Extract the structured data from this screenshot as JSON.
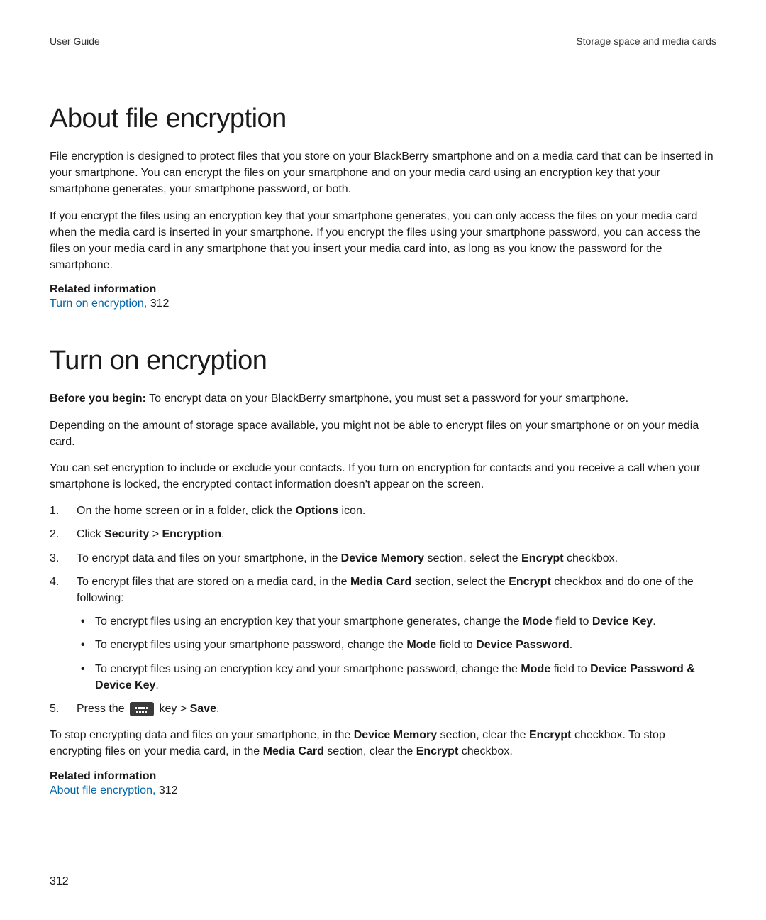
{
  "header": {
    "left": "User Guide",
    "right": "Storage space and media cards"
  },
  "section1": {
    "title": "About file encryption",
    "p1": "File encryption is designed to protect files that you store on your BlackBerry smartphone and on a media card that can be inserted in your smartphone. You can encrypt the files on your smartphone and on your media card using an encryption key that your smartphone generates, your smartphone password, or both.",
    "p2": "If you encrypt the files using an encryption key that your smartphone generates, you can only access the files on your media card when the media card is inserted in your smartphone. If you encrypt the files using your smartphone password, you can access the files on your media card in any smartphone that you insert your media card into, as long as you know the password for the smartphone.",
    "related_title": "Related information",
    "related_link": "Turn on encryption,",
    "related_page": "312"
  },
  "section2": {
    "title": "Turn on encryption",
    "before_label": "Before you begin:",
    "before_text": " To encrypt data on your BlackBerry smartphone, you must set a password for your smartphone.",
    "p2": "Depending on the amount of storage space available, you might not be able to encrypt files on your smartphone or on your media card.",
    "p3": "You can set encryption to include or exclude your contacts. If you turn on encryption for contacts and you receive a call when your smartphone is locked, the encrypted contact information doesn't appear on the screen.",
    "steps": {
      "s1_a": "On the home screen or in a folder, click the ",
      "s1_b": "Options",
      "s1_c": " icon.",
      "s2_a": "Click ",
      "s2_b": "Security",
      "s2_c": " > ",
      "s2_d": "Encryption",
      "s2_e": ".",
      "s3_a": "To encrypt data and files on your smartphone, in the ",
      "s3_b": "Device Memory",
      "s3_c": " section, select the ",
      "s3_d": "Encrypt",
      "s3_e": " checkbox.",
      "s4_a": "To encrypt files that are stored on a media card, in the ",
      "s4_b": "Media Card",
      "s4_c": " section, select the ",
      "s4_d": "Encrypt",
      "s4_e": " checkbox and do one of the following:",
      "b1_a": "To encrypt files using an encryption key that your smartphone generates, change the ",
      "b1_b": "Mode",
      "b1_c": " field to ",
      "b1_d": "Device Key",
      "b1_e": ".",
      "b2_a": "To encrypt files using your smartphone password, change the ",
      "b2_b": "Mode",
      "b2_c": " field to ",
      "b2_d": "Device Password",
      "b2_e": ".",
      "b3_a": "To encrypt files using an encryption key and your smartphone password, change the ",
      "b3_b": "Mode",
      "b3_c": " field to ",
      "b3_d": "Device Password & Device Key",
      "b3_e": ".",
      "s5_a": "Press the ",
      "s5_b": " key > ",
      "s5_c": "Save",
      "s5_d": "."
    },
    "after_a": "To stop encrypting data and files on your smartphone, in the ",
    "after_b": "Device Memory",
    "after_c": " section, clear the ",
    "after_d": "Encrypt",
    "after_e": " checkbox. To stop encrypting files on your media card, in the ",
    "after_f": "Media Card",
    "after_g": " section, clear the ",
    "after_h": "Encrypt",
    "after_i": " checkbox.",
    "related_title": "Related information",
    "related_link": "About file encryption,",
    "related_page": "312"
  },
  "page_number": "312"
}
